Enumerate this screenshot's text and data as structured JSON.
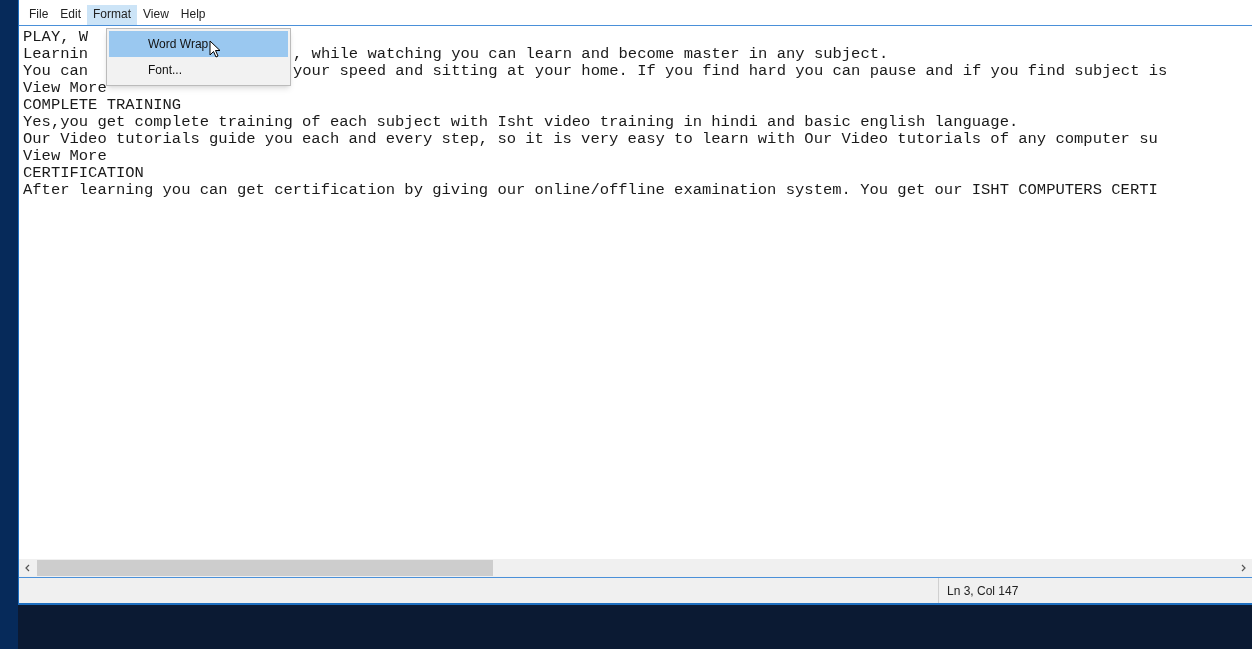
{
  "menu_bar": [
    {
      "label": "File",
      "selected": false
    },
    {
      "label": "Edit",
      "selected": false
    },
    {
      "label": "Format",
      "selected": true
    },
    {
      "label": "View",
      "selected": false
    },
    {
      "label": "Help",
      "selected": false
    }
  ],
  "format_menu": {
    "items": [
      {
        "label": "Word Wrap",
        "selected": true,
        "checked": false
      },
      {
        "label": "Font...",
        "selected": false,
        "checked": false
      }
    ]
  },
  "editor": {
    "lines": [
      {
        "left": "PLAY, W"
      },
      {
        "left": "Learnin",
        "right": ", while watching you can learn and become master in any subject."
      },
      {
        "left": "You can",
        "right": "your speed and sitting at your home. If you find hard you can pause and if you find subject is"
      },
      {
        "left": "View More"
      },
      {
        "left": "COMPLETE TRAINING"
      },
      {
        "left": "Yes,you get complete training of each subject with Isht video training in hindi and basic english language."
      },
      {
        "left": "Our Video tutorials guide you each and every step, so it is very easy to learn with Our Video tutorials of any computer su"
      },
      {
        "left": "View More"
      },
      {
        "left": "CERTIFICATION"
      },
      {
        "left": "After learning you can get certification by giving our online/offline examination system. You get our ISHT COMPUTERS CERTI"
      }
    ]
  },
  "status_bar": {
    "position": "Ln 3, Col 147"
  }
}
